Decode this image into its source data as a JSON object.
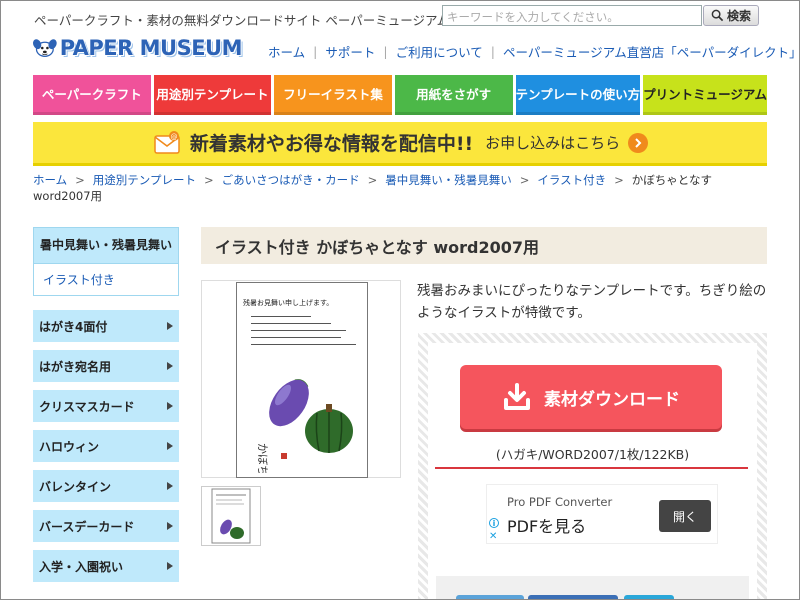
{
  "header": {
    "tagline": "ペーパークラフト・素材の無料ダウンロードサイト ペーパーミュージアム",
    "logo_text": "PAPER MUSEUM",
    "search": {
      "placeholder": "キーワードを入力してください。",
      "button_label": "検索"
    },
    "nav": [
      "ホーム",
      "サポート",
      "ご利用について",
      "ペーパーミュージアム直営店「ペーパーダイレクト」"
    ]
  },
  "menu": [
    {
      "label": "ペーパークラフト",
      "color": "#f0529a"
    },
    {
      "label": "用途別テンプレート",
      "color": "#ee3a3a"
    },
    {
      "label": "フリーイラスト集",
      "color": "#f7941d"
    },
    {
      "label": "用紙をさがす",
      "color": "#4cb848"
    },
    {
      "label": "テンプレートの使い方",
      "color": "#1f8fe0"
    },
    {
      "label": "プリントミュージアム",
      "color": "#c7e21b"
    }
  ],
  "banner": {
    "main": "新着素材やお得な情報を配信中!!",
    "sub": "お申し込みはこちら"
  },
  "breadcrumb": [
    "ホーム",
    "用途別テンプレート",
    "ごあいさつはがき・カード",
    "暑中見舞い・残暑見舞い",
    "イラスト付き",
    "かぼちゃとなす word2007用"
  ],
  "sidebar": {
    "current": "暑中見舞い・残暑見舞い",
    "current_sub": "イラスト付き",
    "items": [
      "はがき4面付",
      "はがき宛名用",
      "クリスマスカード",
      "ハロウィン",
      "バレンタイン",
      "バースデーカード",
      "入学・入園祝い"
    ]
  },
  "main": {
    "title": "イラスト付き かぼちゃとなす word2007用",
    "description": "残暑おみまいにぴったりなテンプレートです。ちぎり絵のようなイラストが特徴です。",
    "card_heading": "残暑お見舞い申し上げます。",
    "download_label": "素材ダウンロード",
    "file_info": "(ハガキ/WORD2007/1枚/122KB)"
  },
  "ad": {
    "company": "Pro PDF Converter",
    "title": "PDFを見る",
    "open_label": "開く"
  }
}
